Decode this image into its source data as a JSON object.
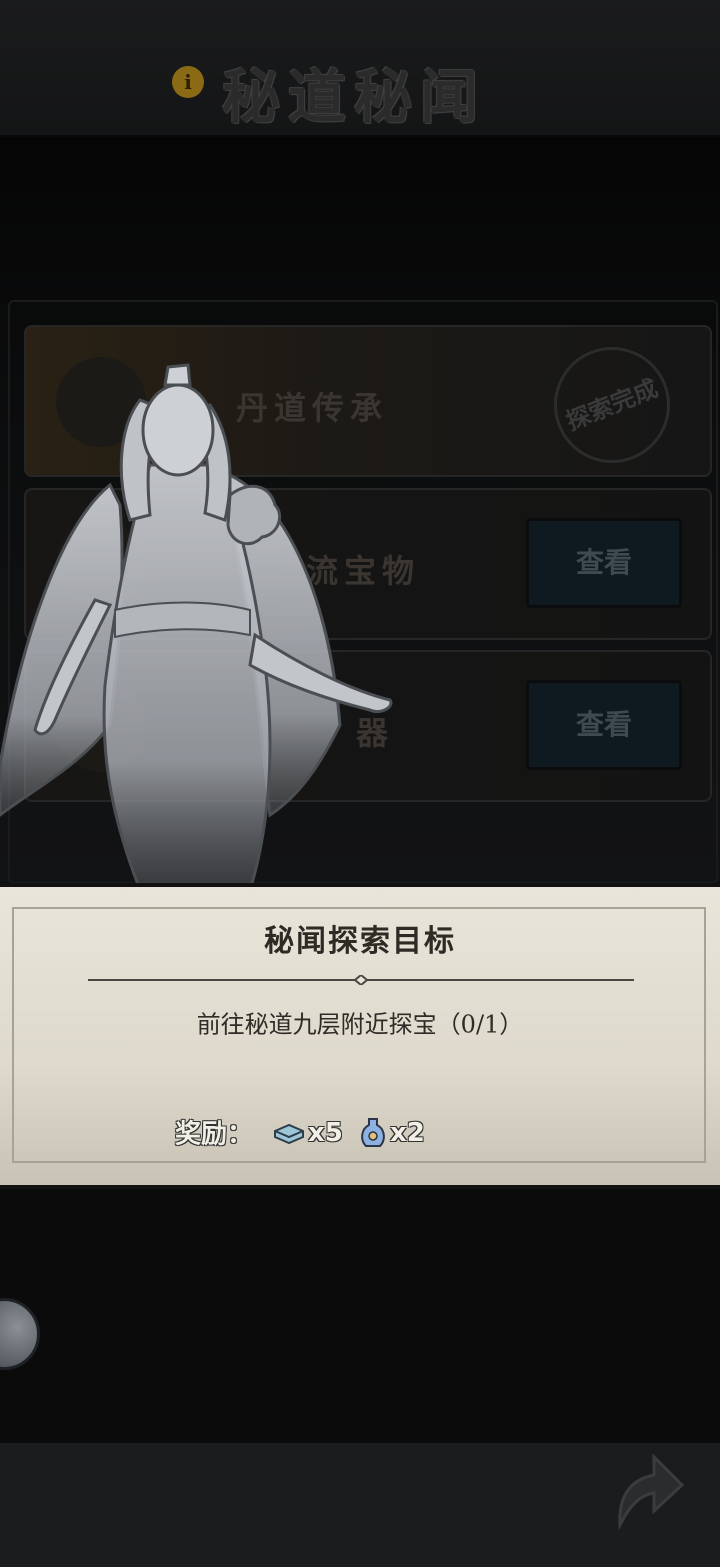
{
  "header": {
    "title": "秘道秘闻",
    "info_icon": "i"
  },
  "cards": [
    {
      "title": "丹道传承",
      "status": "探索完成",
      "icon": "gourd-icon"
    },
    {
      "title": "流宝物",
      "button": "查看",
      "icon": "key-icon"
    },
    {
      "title": "器",
      "button": "查看",
      "icon": "artifact-icon"
    }
  ],
  "panel": {
    "title": "秘闻探索目标",
    "objective": "前往秘道九层附近探宝（0/1）",
    "reward_label": "奖励：",
    "rewards": [
      {
        "icon": "spirit-stone-icon",
        "qty": "x5"
      },
      {
        "icon": "elixir-bottle-icon",
        "qty": "x2"
      }
    ]
  },
  "colors": {
    "panel_bg": "#e8e5da",
    "header_bg": "#1a1b1c"
  }
}
